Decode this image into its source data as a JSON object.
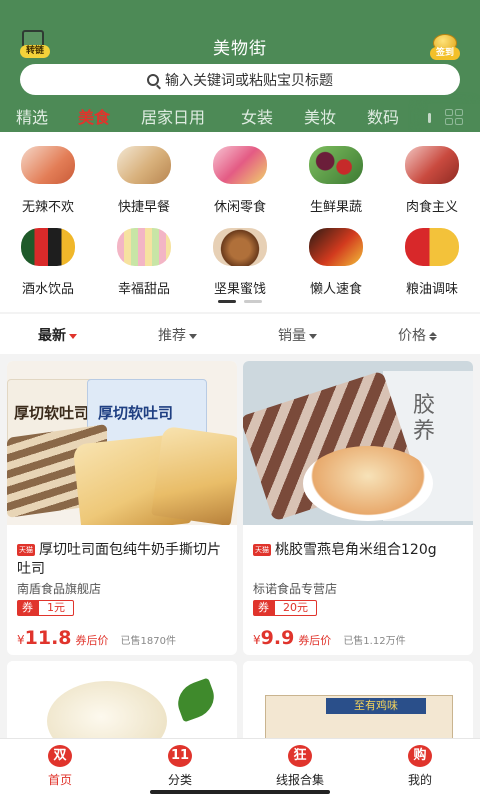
{
  "header": {
    "title": "美物街",
    "left_badge": "转链",
    "right_badge": "签到"
  },
  "search": {
    "placeholder": "输入关键词或粘贴宝贝标题"
  },
  "tabs": [
    {
      "label": "精选"
    },
    {
      "label": "美食"
    },
    {
      "label": "居家日用"
    },
    {
      "label": "女装"
    },
    {
      "label": "美妆"
    },
    {
      "label": "数码"
    }
  ],
  "categories": [
    {
      "label": "无辣不欢"
    },
    {
      "label": "快捷早餐"
    },
    {
      "label": "休闲零食"
    },
    {
      "label": "生鲜果蔬"
    },
    {
      "label": "肉食主义"
    },
    {
      "label": "酒水饮品"
    },
    {
      "label": "幸福甜品"
    },
    {
      "label": "坚果蜜饯"
    },
    {
      "label": "懒人速食"
    },
    {
      "label": "粮油调味"
    }
  ],
  "sort": [
    {
      "label": "最新"
    },
    {
      "label": "推荐"
    },
    {
      "label": "销量"
    },
    {
      "label": "价格"
    }
  ],
  "products": [
    {
      "mall_tag": "天猫",
      "title": "厚切吐司面包纯牛奶手撕切片吐司",
      "shop": "南盾食品旗舰店",
      "coupon_prefix": "券",
      "coupon_value": "1元",
      "currency": "¥",
      "price": "11.8",
      "after_label": "券后价",
      "sold": "已售1870件",
      "image_text_1": "厚切软吐司",
      "image_text_2": "厚切软吐司"
    },
    {
      "mall_tag": "天猫",
      "title": "桃胶雪燕皂角米组合120g",
      "shop": "标诺食品专营店",
      "coupon_prefix": "券",
      "coupon_value": "20元",
      "currency": "¥",
      "price": "9.9",
      "after_label": "券后价",
      "sold": "已售1.12万件",
      "image_text_1": "胶养"
    },
    {
      "image_text_1": ""
    },
    {
      "image_text_1": "至有鸡味"
    }
  ],
  "nav": [
    {
      "icon": "双",
      "label": "首页"
    },
    {
      "icon": "11",
      "label": "分类"
    },
    {
      "icon": "狂",
      "label": "线报合集"
    },
    {
      "icon": "购",
      "label": "我的"
    }
  ],
  "colors": {
    "header": "#4d8a56",
    "accent": "#e0342c"
  }
}
